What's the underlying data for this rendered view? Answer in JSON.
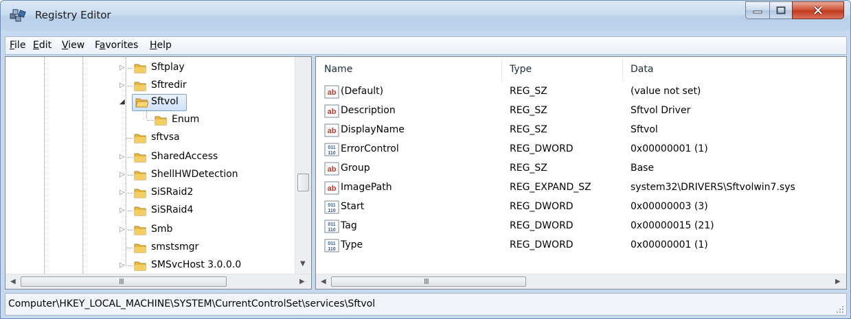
{
  "window": {
    "title": "Registry Editor"
  },
  "menu": [
    {
      "hotkey": "F",
      "rest": "ile"
    },
    {
      "hotkey": "E",
      "rest": "dit"
    },
    {
      "hotkey": "V",
      "rest": "iew"
    },
    {
      "pre": "F",
      "hotkey": "a",
      "rest": "vorites"
    },
    {
      "hotkey": "H",
      "rest": "elp"
    }
  ],
  "tree": {
    "items": [
      {
        "label": "Sftplay",
        "expander": "▷"
      },
      {
        "label": "Sftredir",
        "expander": "▷"
      },
      {
        "label": "Sftvol",
        "expander": "◢",
        "selected": true
      },
      {
        "label": "Enum",
        "expander": ""
      },
      {
        "label": "sftvsa",
        "expander": ""
      },
      {
        "label": "SharedAccess",
        "expander": "▷"
      },
      {
        "label": "ShellHWDetection",
        "expander": "▷"
      },
      {
        "label": "SiSRaid2",
        "expander": "▷"
      },
      {
        "label": "SiSRaid4",
        "expander": "▷"
      },
      {
        "label": "Smb",
        "expander": "▷"
      },
      {
        "label": "smstsmgr",
        "expander": ""
      },
      {
        "label": "SMSvcHost 3.0.0.0",
        "expander": "▷"
      }
    ]
  },
  "list": {
    "columns": [
      "Name",
      "Type",
      "Data"
    ],
    "rows": [
      {
        "icon": "string-value-icon",
        "name": "(Default)",
        "type": "REG_SZ",
        "data": "(value not set)"
      },
      {
        "icon": "string-value-icon",
        "name": "Description",
        "type": "REG_SZ",
        "data": "Sftvol Driver"
      },
      {
        "icon": "string-value-icon",
        "name": "DisplayName",
        "type": "REG_SZ",
        "data": "Sftvol"
      },
      {
        "icon": "binary-value-icon",
        "name": "ErrorControl",
        "type": "REG_DWORD",
        "data": "0x00000001 (1)"
      },
      {
        "icon": "string-value-icon",
        "name": "Group",
        "type": "REG_SZ",
        "data": "Base"
      },
      {
        "icon": "string-value-icon",
        "name": "ImagePath",
        "type": "REG_EXPAND_SZ",
        "data": "system32\\DRIVERS\\Sftvolwin7.sys"
      },
      {
        "icon": "binary-value-icon",
        "name": "Start",
        "type": "REG_DWORD",
        "data": "0x00000003 (3)"
      },
      {
        "icon": "binary-value-icon",
        "name": "Tag",
        "type": "REG_DWORD",
        "data": "0x00000015 (21)"
      },
      {
        "icon": "binary-value-icon",
        "name": "Type",
        "type": "REG_DWORD",
        "data": "0x00000001 (1)"
      }
    ]
  },
  "scroll": {
    "left_h_grip": "III",
    "right_h_grip": "III"
  },
  "status": {
    "path": "Computer\\HKEY_LOCAL_MACHINE\\SYSTEM\\CurrentControlSet\\services\\Sftvol"
  },
  "colors": {
    "folder": "#e8b93f",
    "selection_border": "#7da2ce",
    "string_icon_red": "#c0392b",
    "binary_icon_blue": "#2f5fa8"
  }
}
